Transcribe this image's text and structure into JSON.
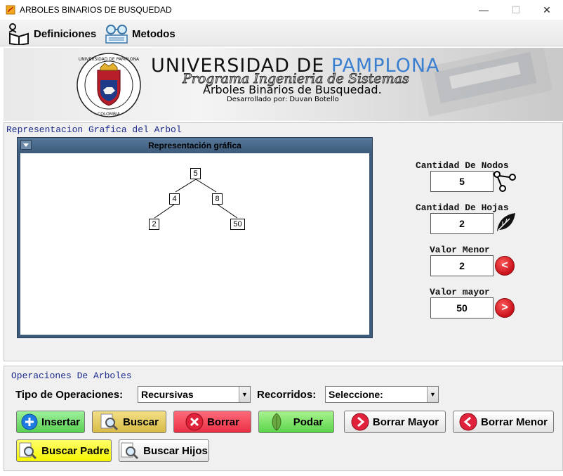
{
  "window": {
    "title": "ARBOLES BINARIOS DE BUSQUEDAD",
    "minimize": "—",
    "maximize": "☐",
    "close": "✕"
  },
  "menu": {
    "definiciones": "Definiciones",
    "metodos": "Metodos"
  },
  "banner": {
    "university_part1": "UNIVERSIDAD DE ",
    "university_part2": "PAMPLONA",
    "program": "Programa Ingenieria de Sistemas",
    "subtitle": "Arboles Binarios de Busquedad.",
    "developer": "Desarrollado por:  Duvan Botello",
    "crest_text": "UNIVERSIDAD DE PAMPLONA",
    "crest_bottom": "COLOMBIA"
  },
  "graph_panel": {
    "title": "Representacion Grafica del Arbol",
    "inner_title": "Representación gráfica",
    "nodes": [
      "5",
      "4",
      "8",
      "2",
      "50"
    ]
  },
  "stats": {
    "nodos_label": "Cantidad De Nodos",
    "nodos_value": "5",
    "hojas_label": "Cantidad De Hojas",
    "hojas_value": "2",
    "menor_label": "Valor Menor",
    "menor_value": "2",
    "mayor_label": "Valor mayor",
    "mayor_value": "50"
  },
  "operations": {
    "title": "Operaciones De Arboles",
    "tipo_label": "Tipo de Operaciones:",
    "tipo_value": "Recursivas",
    "recorridos_label": "Recorridos:",
    "recorridos_value": "Seleccione:",
    "buttons": {
      "insertar": "Insertar",
      "buscar": "Buscar",
      "borrar": "Borrar",
      "podar": "Podar",
      "borrar_mayor": "Borrar Mayor",
      "borrar_menor": "Borrar Menor",
      "buscar_padre": "Buscar Padre",
      "buscar_hijos": "Buscar Hijos"
    }
  },
  "colors": {
    "panel_title": "#1b2a8c",
    "university_accent": "#3a7fd0",
    "graph_frame": "#3d5b7a"
  }
}
